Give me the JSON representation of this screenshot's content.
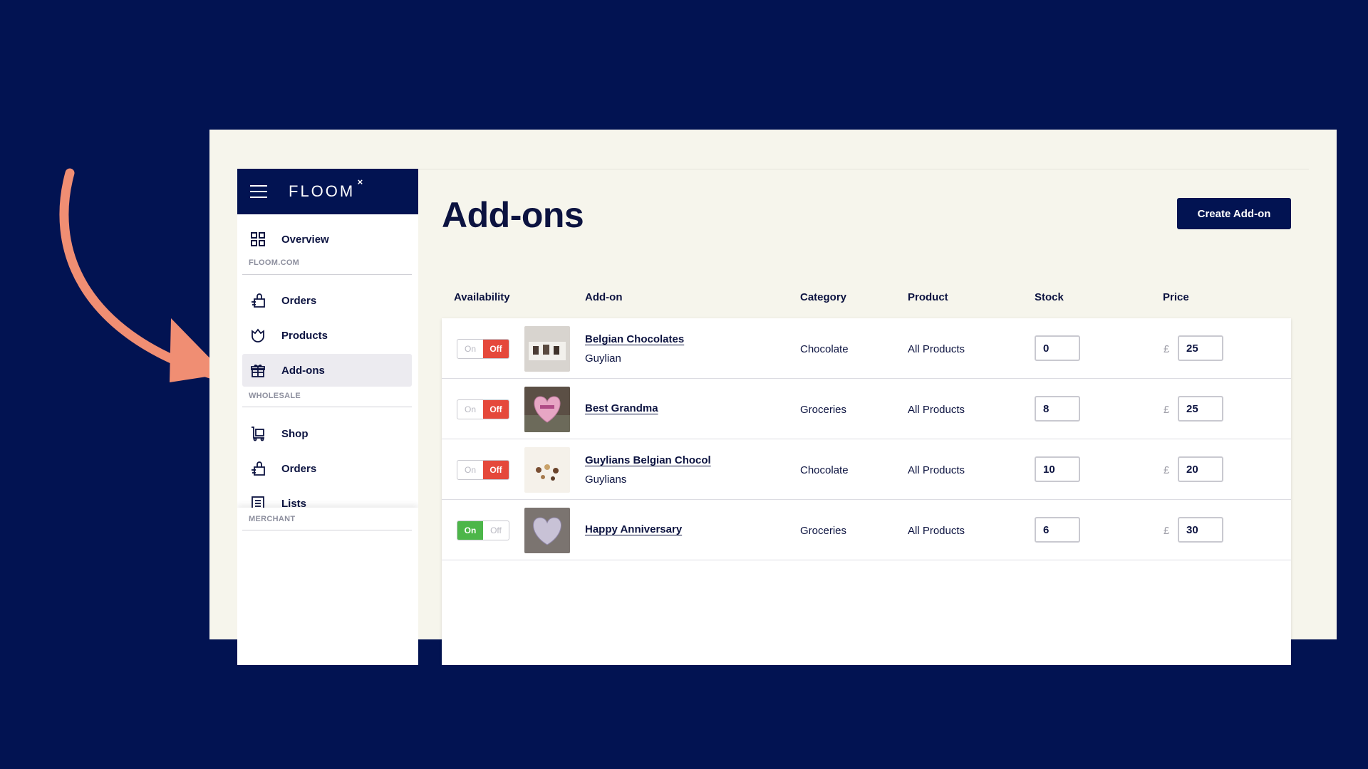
{
  "app": {
    "logo_text": "FLOOM",
    "logo_mark": "×",
    "accent_color": "#021352",
    "toggle_on_color": "#4cb649",
    "toggle_off_color": "#e5483b"
  },
  "sidebar": {
    "overview_label": "Overview",
    "section_floom": "FLOOM.COM",
    "orders_label": "Orders",
    "products_label": "Products",
    "addons_label": "Add-ons",
    "section_wholesale": "WHOLESALE",
    "shop_label": "Shop",
    "wholesale_orders_label": "Orders",
    "lists_label": "Lists",
    "section_merchant": "MERCHANT"
  },
  "main": {
    "title": "Add-ons",
    "create_button": "Create Add-on",
    "columns": {
      "availability": "Availability",
      "addon": "Add-on",
      "category": "Category",
      "product": "Product",
      "stock": "Stock",
      "price": "Price"
    },
    "toggle_on": "On",
    "toggle_off": "Off",
    "currency": "£",
    "rows": [
      {
        "available": false,
        "name": "Belgian Chocolates",
        "brand": "Guylian",
        "category": "Chocolate",
        "product": "All Products",
        "stock": "0",
        "price": "25",
        "thumb_icon": "chocolate-box-image"
      },
      {
        "available": false,
        "name": "Best Grandma",
        "brand": "",
        "category": "Groceries",
        "product": "All Products",
        "stock": "8",
        "price": "25",
        "thumb_icon": "heart-balloon-image"
      },
      {
        "available": false,
        "name": "Guylians Belgian Chocol",
        "brand": "Guylians",
        "category": "Chocolate",
        "product": "All Products",
        "stock": "10",
        "price": "20",
        "thumb_icon": "chocolates-image"
      },
      {
        "available": true,
        "name": "Happy Anniversary",
        "brand": "",
        "category": "Groceries",
        "product": "All Products",
        "stock": "6",
        "price": "30",
        "thumb_icon": "balloon-image"
      }
    ]
  }
}
